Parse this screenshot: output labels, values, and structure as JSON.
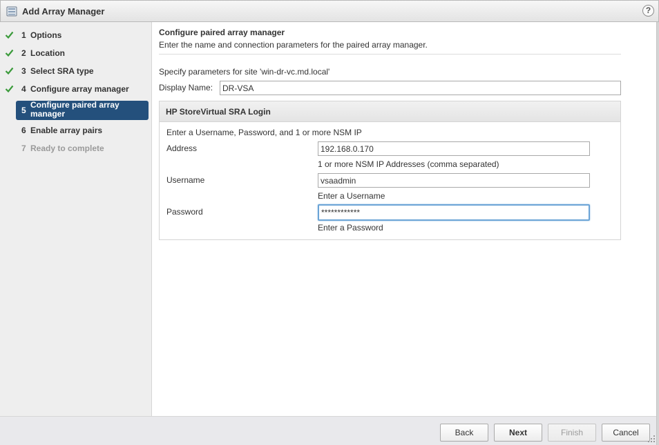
{
  "window": {
    "title": "Add Array Manager",
    "help_label": "?"
  },
  "steps": [
    {
      "num": "1",
      "label": "Options",
      "state": "done"
    },
    {
      "num": "2",
      "label": "Location",
      "state": "done"
    },
    {
      "num": "3",
      "label": "Select SRA type",
      "state": "done"
    },
    {
      "num": "4",
      "label": "Configure array manager",
      "state": "done"
    },
    {
      "num": "5",
      "label": "Configure paired array manager",
      "state": "active"
    },
    {
      "num": "6",
      "label": "Enable array pairs",
      "state": "pending"
    },
    {
      "num": "7",
      "label": "Ready to complete",
      "state": "disabled"
    }
  ],
  "main": {
    "heading": "Configure paired array manager",
    "subheading": "Enter the name and connection parameters for the paired array manager.",
    "site_text": "Specify parameters for site 'win-dr-vc.md.local'",
    "display_name_label": "Display Name:",
    "display_name_value": "DR-VSA"
  },
  "panel": {
    "title": "HP StoreVirtual SRA Login",
    "intro": "Enter a Username, Password, and 1 or more NSM IP",
    "fields": [
      {
        "label": "Address",
        "value": "192.168.0.170",
        "help": "1 or more NSM IP Addresses (comma separated)"
      },
      {
        "label": "Username",
        "value": "vsaadmin",
        "help": "Enter a Username"
      },
      {
        "label": "Password",
        "value": "************",
        "help": "Enter a Password"
      }
    ]
  },
  "footer": {
    "back_label": "Back",
    "next_label": "Next",
    "finish_label": "Finish",
    "cancel_label": "Cancel"
  },
  "colors": {
    "accent": "#24507c",
    "check": "#3a9a3a",
    "focus": "#6ba4d6"
  },
  "icons": {
    "app": "storage-array-icon",
    "done": "check-icon",
    "resize": "resize-grip-icon"
  }
}
